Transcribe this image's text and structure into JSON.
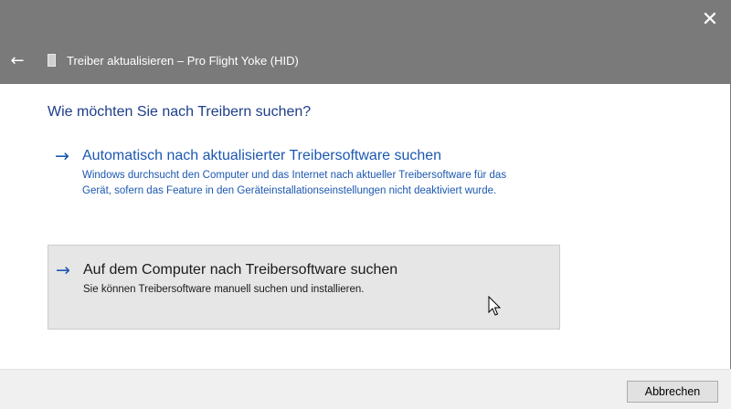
{
  "window": {
    "title": "Treiber aktualisieren – Pro Flight Yoke (HID)",
    "close_glyph": "✕",
    "back_glyph": "←"
  },
  "content": {
    "question": "Wie möchten Sie nach Treibern suchen?",
    "options": [
      {
        "arrow": "→",
        "title": "Automatisch nach aktualisierter Treibersoftware suchen",
        "description": "Windows durchsucht den Computer und das Internet nach aktueller Treibersoftware für das Gerät, sofern das Feature in den Geräteinstallationseinstellungen nicht deaktiviert wurde."
      },
      {
        "arrow": "→",
        "title": "Auf dem Computer nach Treibersoftware suchen",
        "description": "Sie können Treibersoftware manuell suchen und installieren."
      }
    ]
  },
  "footer": {
    "cancel_label": "Abbrechen"
  },
  "colors": {
    "titlebar": "#7a7a7a",
    "link_blue": "#1c58b0",
    "heading_blue": "#1e3d8a",
    "hover_bg": "#e6e6e6",
    "footer_bg": "#f0f0f0"
  },
  "icons": {
    "back": "back-arrow-icon",
    "close": "close-icon",
    "device": "device-icon",
    "option_arrow": "arrow-right-icon",
    "cursor": "mouse-cursor-icon"
  }
}
